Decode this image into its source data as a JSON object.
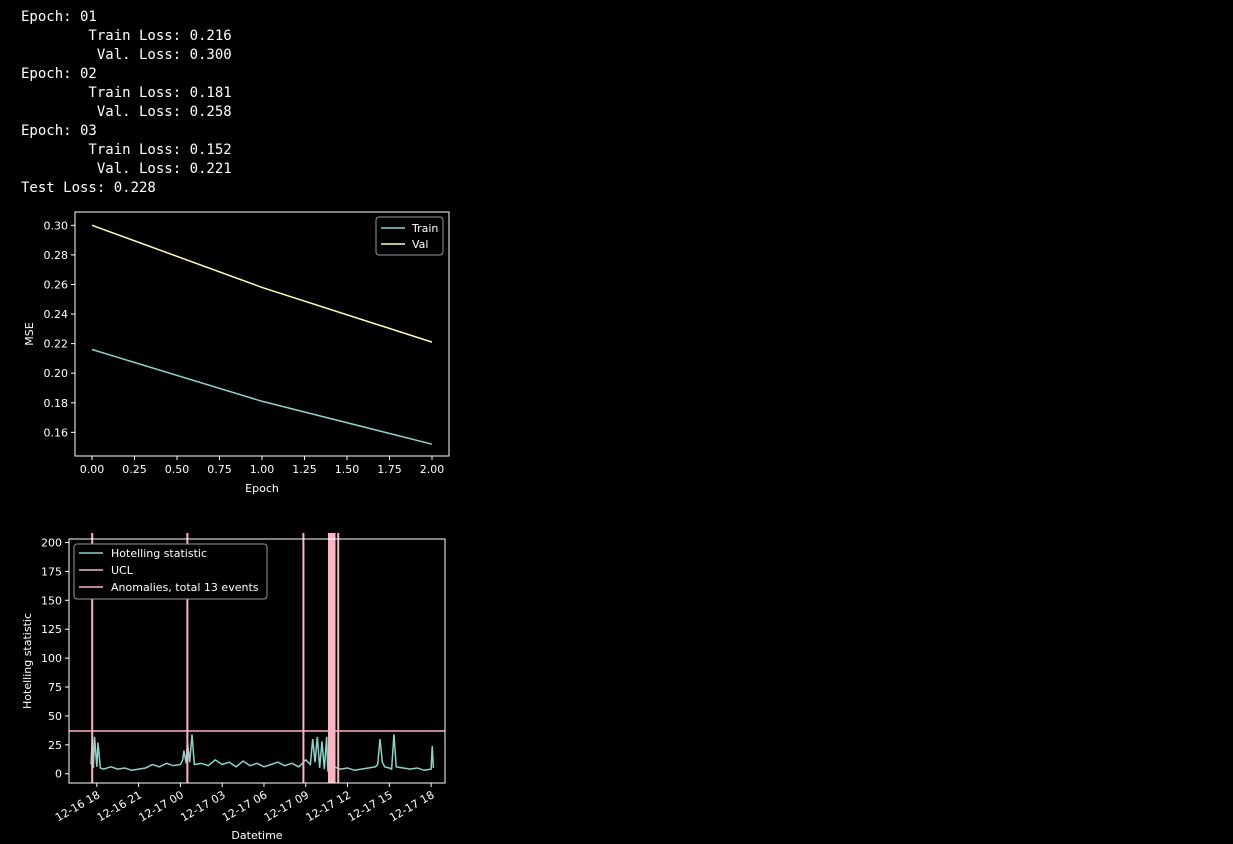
{
  "output_log": [
    "Epoch: 01",
    "        Train Loss: 0.216",
    "         Val. Loss: 0.300",
    "Epoch: 02",
    "        Train Loss: 0.181",
    "         Val. Loss: 0.258",
    "Epoch: 03",
    "        Train Loss: 0.152",
    "         Val. Loss: 0.221",
    "Test Loss: 0.228"
  ],
  "colors": {
    "background": "#000000",
    "train": "#8dd3c7",
    "val": "#feffb3",
    "hotelling": "#8dd3c7",
    "ucl": "#fbb4c4",
    "anomaly": "#fbb4c4",
    "text": "#ffffff"
  },
  "chart_data": [
    {
      "type": "line",
      "xlabel": "Epoch",
      "ylabel": "MSE",
      "xlim": [
        -0.1,
        2.1
      ],
      "ylim": [
        0.144,
        0.309
      ],
      "xticks": [
        "0.00",
        "0.25",
        "0.50",
        "0.75",
        "1.00",
        "1.25",
        "1.50",
        "1.75",
        "2.00"
      ],
      "xtick_values": [
        0,
        0.25,
        0.5,
        0.75,
        1,
        1.25,
        1.5,
        1.75,
        2
      ],
      "yticks": [
        "0.16",
        "0.18",
        "0.20",
        "0.22",
        "0.24",
        "0.26",
        "0.28",
        "0.30"
      ],
      "ytick_values": [
        0.16,
        0.18,
        0.2,
        0.22,
        0.24,
        0.26,
        0.28,
        0.3
      ],
      "legend_position": "top-right",
      "x": [
        0,
        1,
        2
      ],
      "series": [
        {
          "name": "Train",
          "values": [
            0.216,
            0.181,
            0.152
          ]
        },
        {
          "name": "Val",
          "values": [
            0.3,
            0.258,
            0.221
          ]
        }
      ]
    },
    {
      "type": "line",
      "xlabel": "Datetime",
      "ylabel": "Hotelling statistic",
      "ylim": [
        -8,
        203
      ],
      "yticks": [
        "0",
        "25",
        "50",
        "75",
        "100",
        "125",
        "150",
        "175",
        "200"
      ],
      "ytick_values": [
        0,
        25,
        50,
        75,
        100,
        125,
        150,
        175,
        200
      ],
      "xlim": [
        "2016-12-16 16:00",
        "2016-12-17 19:00"
      ],
      "xticks": [
        "12-16 18",
        "12-16 21",
        "12-17 00",
        "12-17 03",
        "12-17 06",
        "12-17 09",
        "12-17 12",
        "12-17 15",
        "12-17 18"
      ],
      "xtick_values": [
        "2016-12-16 18:00",
        "2016-12-16 21:00",
        "2016-12-17 00:00",
        "2016-12-17 03:00",
        "2016-12-17 06:00",
        "2016-12-17 09:00",
        "2016-12-17 12:00",
        "2016-12-17 15:00",
        "2016-12-17 18:00"
      ],
      "legend_position": "top-left",
      "series": [
        {
          "name": "Hotelling statistic",
          "x": [
            "2016-12-16 17:35",
            "2016-12-16 17:40",
            "2016-12-16 17:45",
            "2016-12-16 17:50",
            "2016-12-16 18:00",
            "2016-12-16 18:05",
            "2016-12-16 18:15",
            "2016-12-16 18:30",
            "2016-12-16 19:00",
            "2016-12-16 19:30",
            "2016-12-16 20:00",
            "2016-12-16 20:30",
            "2016-12-16 21:00",
            "2016-12-16 21:30",
            "2016-12-16 22:00",
            "2016-12-16 22:30",
            "2016-12-16 23:00",
            "2016-12-16 23:30",
            "2016-12-17 00:00",
            "2016-12-17 00:10",
            "2016-12-17 00:15",
            "2016-12-17 00:25",
            "2016-12-17 00:30",
            "2016-12-17 00:40",
            "2016-12-17 00:50",
            "2016-12-17 01:00",
            "2016-12-17 01:30",
            "2016-12-17 02:00",
            "2016-12-17 02:30",
            "2016-12-17 03:00",
            "2016-12-17 03:30",
            "2016-12-17 04:00",
            "2016-12-17 04:30",
            "2016-12-17 05:00",
            "2016-12-17 05:30",
            "2016-12-17 06:00",
            "2016-12-17 06:30",
            "2016-12-17 07:00",
            "2016-12-17 07:30",
            "2016-12-17 08:00",
            "2016-12-17 08:30",
            "2016-12-17 09:00",
            "2016-12-17 09:20",
            "2016-12-17 09:30",
            "2016-12-17 09:40",
            "2016-12-17 09:50",
            "2016-12-17 10:00",
            "2016-12-17 10:10",
            "2016-12-17 10:20",
            "2016-12-17 10:30",
            "2016-12-17 10:35",
            "2016-12-17 10:45",
            "2016-12-17 11:00",
            "2016-12-17 11:30",
            "2016-12-17 12:00",
            "2016-12-17 12:30",
            "2016-12-17 13:00",
            "2016-12-17 13:30",
            "2016-12-17 14:00",
            "2016-12-17 14:10",
            "2016-12-17 14:20",
            "2016-12-17 14:30",
            "2016-12-17 14:40",
            "2016-12-17 15:00",
            "2016-12-17 15:10",
            "2016-12-17 15:20",
            "2016-12-17 15:30",
            "2016-12-17 16:00",
            "2016-12-17 16:30",
            "2016-12-17 17:00",
            "2016-12-17 17:30",
            "2016-12-17 18:00",
            "2016-12-17 18:05",
            "2016-12-17 18:10"
          ],
          "values": [
            8,
            30,
            5,
            32,
            6,
            27,
            5,
            4,
            6,
            4,
            5,
            3,
            4,
            5,
            8,
            6,
            9,
            7,
            8,
            12,
            20,
            9,
            28,
            10,
            34,
            8,
            9,
            7,
            12,
            8,
            10,
            6,
            11,
            7,
            9,
            6,
            8,
            10,
            7,
            9,
            6,
            12,
            8,
            30,
            10,
            32,
            5,
            28,
            4,
            32,
            3,
            5,
            6,
            4,
            5,
            3,
            4,
            5,
            6,
            8,
            30,
            10,
            6,
            5,
            4,
            34,
            6,
            5,
            4,
            5,
            3,
            4,
            24,
            5
          ]
        },
        {
          "name": "UCL",
          "value": 37
        },
        {
          "name": "Anomalies, total 13 events",
          "x": [
            "2016-12-16 17:40",
            "2016-12-17 00:30",
            "2016-12-17 08:50",
            "2016-12-17 10:40",
            "2016-12-17 10:43",
            "2016-12-17 10:46",
            "2016-12-17 10:49",
            "2016-12-17 10:52",
            "2016-12-17 10:55",
            "2016-12-17 10:58",
            "2016-12-17 11:01",
            "2016-12-17 11:04",
            "2016-12-17 11:20"
          ]
        }
      ]
    }
  ]
}
